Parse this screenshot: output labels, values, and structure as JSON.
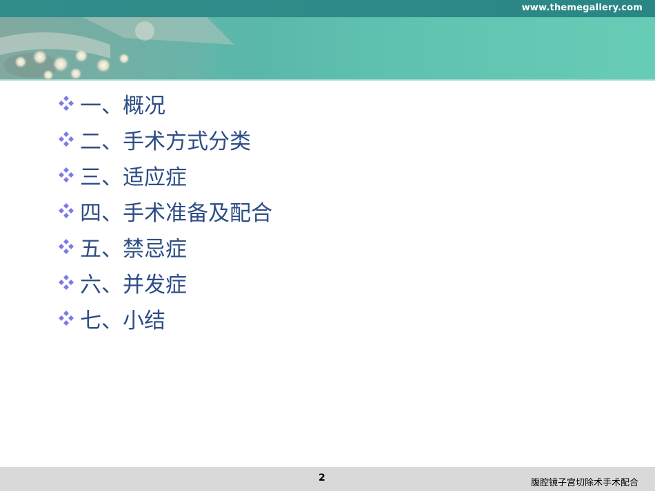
{
  "header": {
    "site_url": "www.themegallery.com"
  },
  "agenda": {
    "items": [
      "一、概况",
      "二、手术方式分类",
      "三、适应症",
      "四、手术准备及配合",
      "五、禁忌症",
      "六、并发症",
      "七、小结"
    ]
  },
  "footer": {
    "page_number": "2",
    "title": "腹腔镜子宫切除术手术配合"
  },
  "colors": {
    "top_bar": "#2f8d8a",
    "banner_end": "#67ccb6",
    "text": "#2e4d86",
    "bullet": "#7b7be6",
    "footer_bg": "#d9d9d9"
  },
  "icons": {
    "bullet": "four-diamond-bullet-icon",
    "banner_image": "surgical-lamp-image"
  }
}
